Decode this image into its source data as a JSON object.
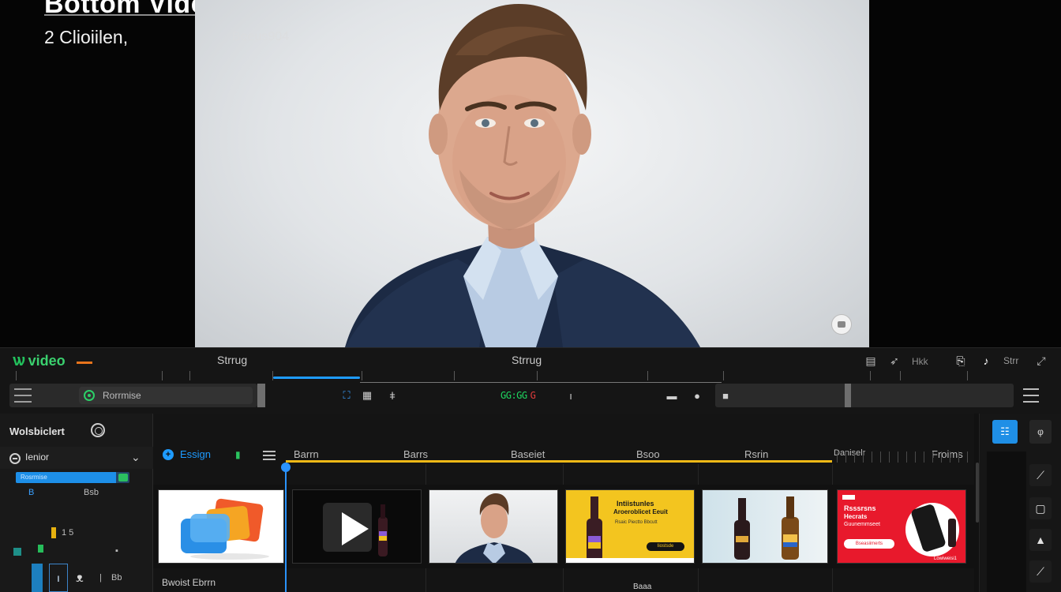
{
  "preview": {
    "title": "Bottom Video",
    "subtitle": "2 Clioiilen,",
    "watermark": "Beeus904"
  },
  "toolbar": {
    "logo_text": "video",
    "label_left": "Strrug",
    "label_center": "Strrug",
    "right_text": "Strr",
    "icon_labels_right": "Hkk",
    "tracks_pill_label": "Rorrmise",
    "timecode_green": "GG:GG",
    "timecode_red": "G"
  },
  "left_panel": {
    "title": "Wolsbiclert",
    "filter_label": "Ienior",
    "meter_text": "Rosrmise",
    "meter_level": 0.88,
    "row_label_a": "B",
    "row_label_b": "Bsb",
    "row_label_c": "1 5",
    "row_label_d": "Bb"
  },
  "timeline": {
    "track_label": "Essign",
    "markers": [
      "Barrn",
      "Barrs",
      "Baseiet",
      "Bsoo",
      "Rsrin",
      "Daniselr",
      "Froims"
    ],
    "track_caption": "Bwoist Ebrrn",
    "track_caption_2": "Baaa",
    "clips": [
      {
        "name": "clip-1",
        "kind": "3d-shapes"
      },
      {
        "name": "clip-2",
        "kind": "video-play"
      },
      {
        "name": "clip-3",
        "kind": "portrait"
      },
      {
        "name": "clip-4",
        "kind": "product-banner",
        "headline": "Intiistunles",
        "line2": "Aroeroblicet Eeuit",
        "line3": "Rsaic Piectto Bbcutt",
        "button": "Iiostsde"
      },
      {
        "name": "clip-5",
        "kind": "bottles"
      },
      {
        "name": "clip-6",
        "kind": "red-ad",
        "headline": "Rsssrsns",
        "line2": "Hecrats",
        "line3": "Guunemmseet",
        "button": "Bseasiimerts",
        "footer": "Lowiweisi1"
      }
    ]
  },
  "right_panel": {
    "grid_label": "☷",
    "tag_label": "φ"
  },
  "colors": {
    "accent_blue": "#1e9bff",
    "accent_green": "#2bd067",
    "accent_orange": "#f0b917",
    "logo_dash": "#e8741c"
  }
}
